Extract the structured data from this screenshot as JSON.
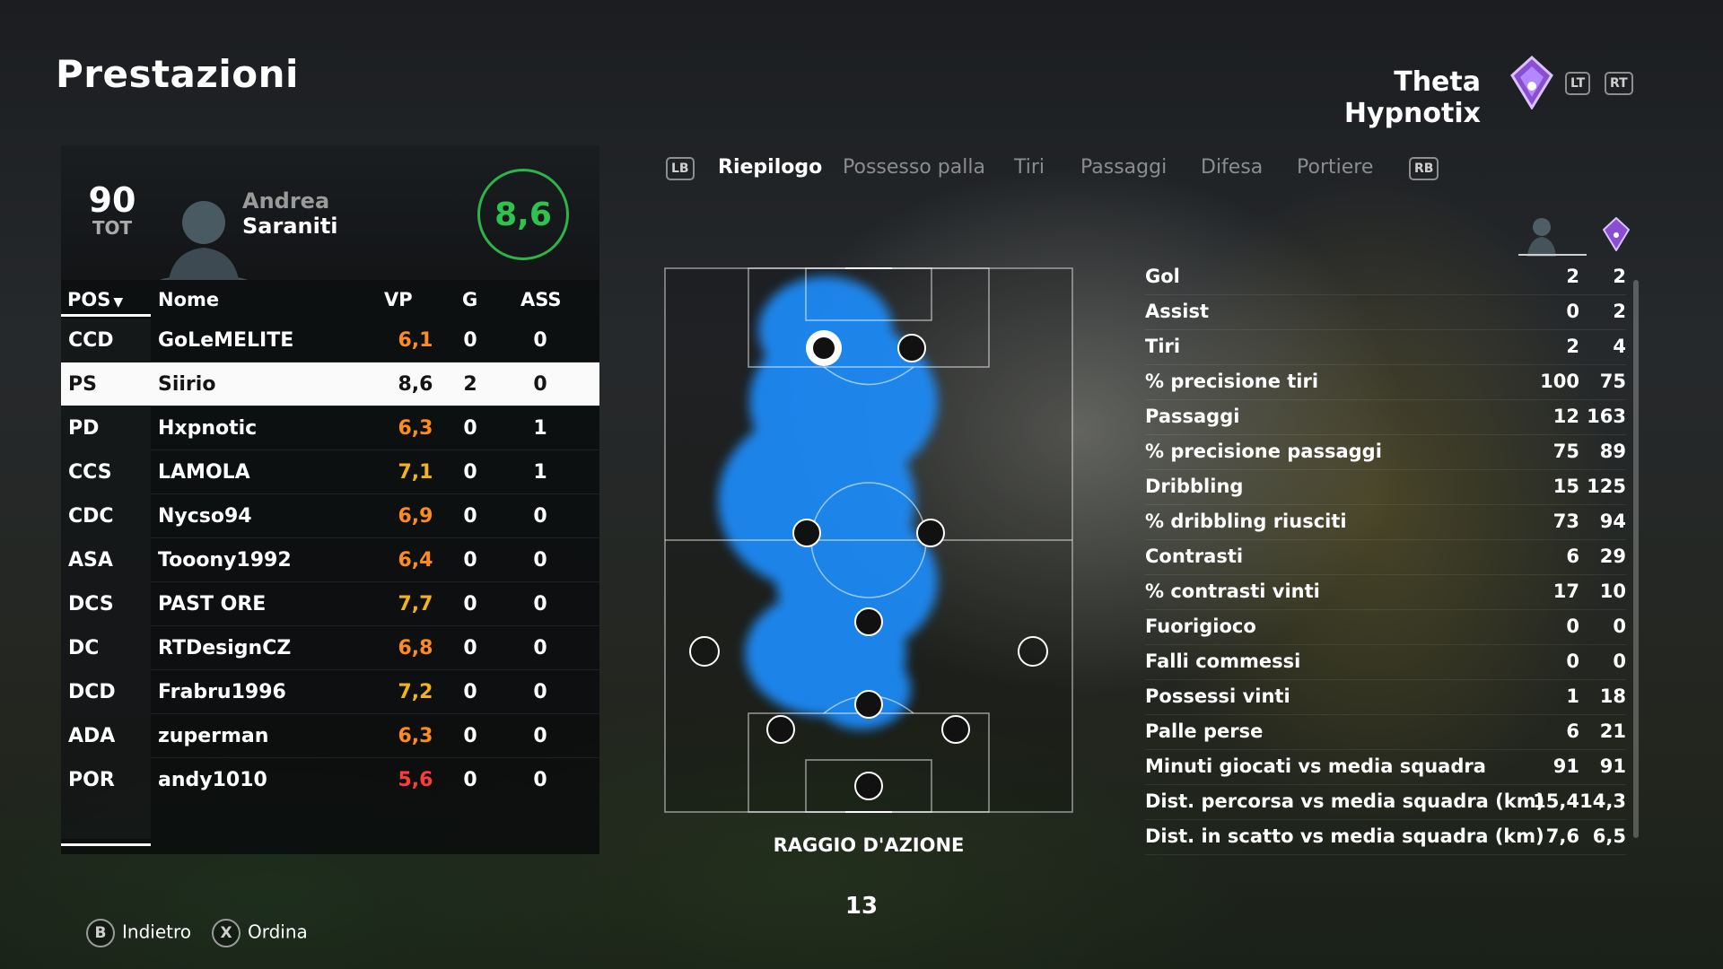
{
  "page_title": "Prestazioni",
  "team": {
    "name": "Theta Hypnotix",
    "lt_label": "LT",
    "rt_label": "RT"
  },
  "player": {
    "ovr": "90",
    "ovr_label": "TOT",
    "first_name": "Andrea",
    "last_name": "Saraniti",
    "match_rating": "8,6"
  },
  "table": {
    "headers": {
      "pos": "POS",
      "name": "Nome",
      "vp": "VP",
      "g": "G",
      "ass": "ASS"
    },
    "rows": [
      {
        "pos": "CCD",
        "name": "GoLeMELITE",
        "vp": "6,1",
        "g": "0",
        "ass": "0",
        "vp_color": "#ff8c1a"
      },
      {
        "pos": "PS",
        "name": "Siirio",
        "vp": "8,6",
        "g": "2",
        "ass": "0",
        "vp_color": "#141414"
      },
      {
        "pos": "PD",
        "name": "Hxpnotic",
        "vp": "6,3",
        "g": "0",
        "ass": "1",
        "vp_color": "#ff8c1a"
      },
      {
        "pos": "CCS",
        "name": "LAMOLA",
        "vp": "7,1",
        "g": "0",
        "ass": "1",
        "vp_color": "#f2b21b"
      },
      {
        "pos": "CDC",
        "name": "Nycso94",
        "vp": "6,9",
        "g": "0",
        "ass": "0",
        "vp_color": "#ff8c1a"
      },
      {
        "pos": "ASA",
        "name": "Tooony1992",
        "vp": "6,4",
        "g": "0",
        "ass": "0",
        "vp_color": "#ff8c1a"
      },
      {
        "pos": "DCS",
        "name": "PAST ORE",
        "vp": "7,7",
        "g": "0",
        "ass": "0",
        "vp_color": "#f2b21b"
      },
      {
        "pos": "DC",
        "name": "RTDesignCZ",
        "vp": "6,8",
        "g": "0",
        "ass": "0",
        "vp_color": "#ff8c1a"
      },
      {
        "pos": "DCD",
        "name": "Frabru1996",
        "vp": "7,2",
        "g": "0",
        "ass": "0",
        "vp_color": "#f2b21b"
      },
      {
        "pos": "ADA",
        "name": "zuperman",
        "vp": "6,3",
        "g": "0",
        "ass": "0",
        "vp_color": "#ff8c1a"
      },
      {
        "pos": "POR",
        "name": "andy1010",
        "vp": "5,6",
        "g": "0",
        "ass": "0",
        "vp_color": "#ff3b3b"
      }
    ]
  },
  "tabs": {
    "lb": "LB",
    "rb": "RB",
    "items": [
      "Riepilogo",
      "Possesso palla",
      "Tiri",
      "Passaggi",
      "Difesa",
      "Portiere"
    ],
    "active": "Riepilogo"
  },
  "heatmap": {
    "label": "RAGGIO D'AZIONE"
  },
  "page_number": "13",
  "stats": [
    {
      "label": "Gol",
      "player": "2",
      "team": "2"
    },
    {
      "label": "Assist",
      "player": "0",
      "team": "2"
    },
    {
      "label": "Tiri",
      "player": "2",
      "team": "4"
    },
    {
      "label": "% precisione tiri",
      "player": "100",
      "team": "75"
    },
    {
      "label": "Passaggi",
      "player": "12",
      "team": "163"
    },
    {
      "label": "% precisione passaggi",
      "player": "75",
      "team": "89"
    },
    {
      "label": "Dribbling",
      "player": "15",
      "team": "125"
    },
    {
      "label": "% dribbling riusciti",
      "player": "73",
      "team": "94"
    },
    {
      "label": "Contrasti",
      "player": "6",
      "team": "29"
    },
    {
      "label": "% contrasti vinti",
      "player": "17",
      "team": "10"
    },
    {
      "label": "Fuorigioco",
      "player": "0",
      "team": "0"
    },
    {
      "label": "Falli commessi",
      "player": "0",
      "team": "0"
    },
    {
      "label": "Possessi vinti",
      "player": "1",
      "team": "18"
    },
    {
      "label": "Palle perse",
      "player": "6",
      "team": "21"
    },
    {
      "label": "Minuti giocati vs media squadra",
      "player": "91",
      "team": "91"
    },
    {
      "label": "Dist. percorsa vs media squadra (km)",
      "player": "15,4",
      "team": "14,3"
    },
    {
      "label": "Dist. in scatto vs media squadra (km)",
      "player": "7,6",
      "team": "6,5"
    }
  ],
  "footer": {
    "back_key": "B",
    "back_label": "Indietro",
    "sort_key": "X",
    "sort_label": "Ordina"
  },
  "colors": {
    "rating_ring": "#2db44a",
    "heat": "#1e90ff",
    "vp_high": "#f2b21b",
    "vp_mid": "#ff8c1a",
    "vp_low": "#ff3b3b"
  }
}
